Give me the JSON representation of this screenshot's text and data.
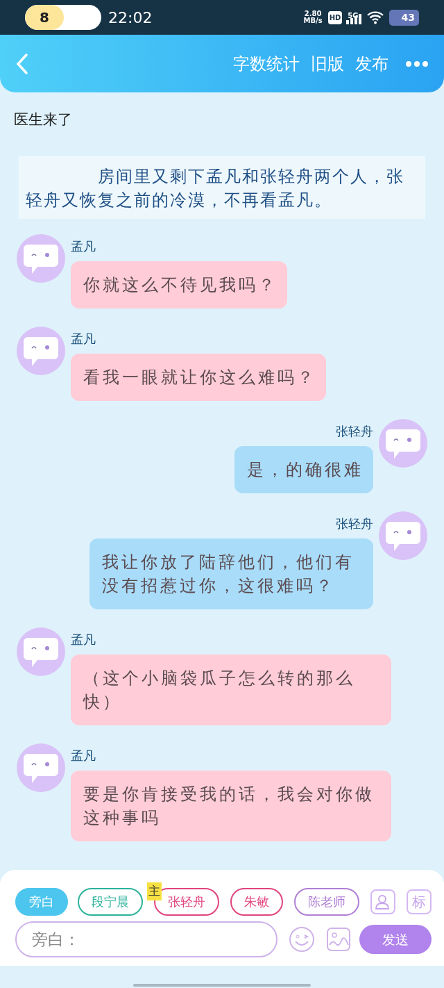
{
  "status_bar": {
    "notification_count": "8",
    "time": "22:02",
    "speed": "2.80\nMB/s",
    "hd": "HD",
    "network": "5G",
    "battery": "43"
  },
  "header": {
    "actions": [
      "字数统计",
      "旧版",
      "发布"
    ]
  },
  "chapter_title": "医生来了",
  "messages": [
    {
      "kind": "narration",
      "text": "房间里又剩下孟凡和张轻舟两个人，张轻舟又恢复之前的冷漠，不再看孟凡。"
    },
    {
      "kind": "left",
      "name": "孟凡",
      "text": "你就这么不待见我吗？"
    },
    {
      "kind": "left",
      "name": "孟凡",
      "text": "看我一眼就让你这么难吗？"
    },
    {
      "kind": "right",
      "name": "张轻舟",
      "text": "是，的确很难"
    },
    {
      "kind": "right",
      "name": "张轻舟",
      "text": "我让你放了陆辞他们，他们有没有招惹过你，这很难吗？"
    },
    {
      "kind": "left",
      "name": "孟凡",
      "text": "（这个小脑袋瓜子怎么转的那么快）"
    },
    {
      "kind": "left",
      "name": "孟凡",
      "text": "要是你肯接受我的话，我会对你做这种事吗"
    }
  ],
  "characters": [
    {
      "label": "旁白",
      "color": "#4cc6ee",
      "selected": true
    },
    {
      "label": "段宁晨",
      "color": "#2bb39a",
      "selected": false
    },
    {
      "label": "张轻舟",
      "color": "#e0457f",
      "selected": false,
      "badge": "主"
    },
    {
      "label": "朱敏",
      "color": "#e0457f",
      "selected": false
    },
    {
      "label": "陈老师",
      "color": "#b07fd6",
      "selected": false
    }
  ],
  "tool_buttons": [
    "标"
  ],
  "input": {
    "placeholder": "旁白："
  },
  "send_button": "发送"
}
